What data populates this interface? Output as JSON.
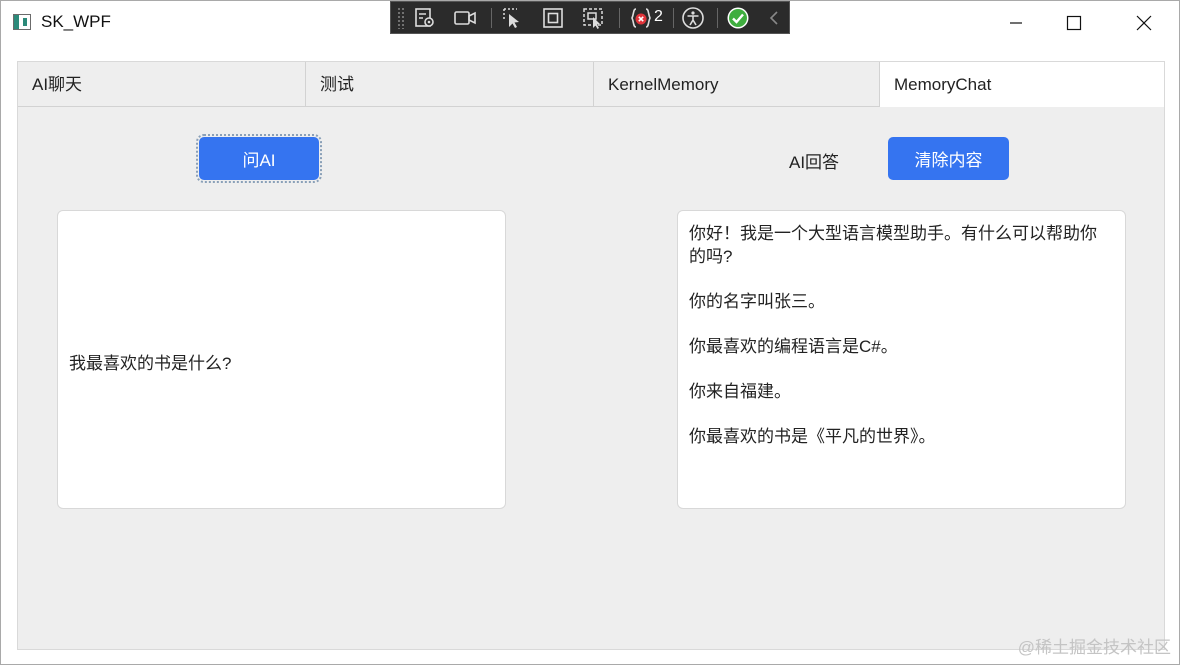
{
  "window": {
    "title": "SK_WPF"
  },
  "debug_toolbar": {
    "icons": [
      "live-visual-tree-icon",
      "video-icon",
      "select-element-icon",
      "display-layout-icon",
      "track-focus-icon",
      "binding-errors-icon",
      "accessibility-icon",
      "hot-reload-ok-icon",
      "collapse-chevron-icon"
    ],
    "error_count": "2"
  },
  "tabs": [
    {
      "label": "AI聊天",
      "active": false
    },
    {
      "label": "测试",
      "active": false
    },
    {
      "label": "KernelMemory",
      "active": false
    },
    {
      "label": "MemoryChat",
      "active": true
    }
  ],
  "left_panel": {
    "ask_button": "问AI",
    "question_text": "我最喜欢的书是什么?"
  },
  "right_panel": {
    "answer_label": "AI回答",
    "clear_button": "清除内容",
    "answer_paragraphs": [
      "你好！我是一个大型语言模型助手。有什么可以帮助你的吗?",
      "你的名字叫张三。",
      "你最喜欢的编程语言是C#。",
      "你来自福建。",
      "你最喜欢的书是《平凡的世界》。"
    ]
  },
  "watermark": "@稀土掘金技术社区",
  "colors": {
    "accent": "#3574f0",
    "content_bg": "#eeeeee"
  }
}
